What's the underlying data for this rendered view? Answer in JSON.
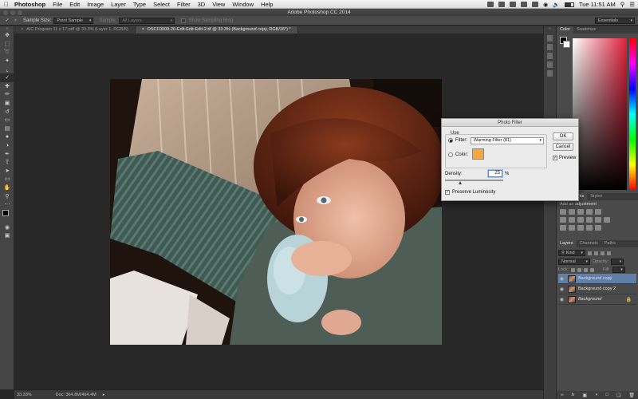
{
  "menubar": {
    "app": "Photoshop",
    "menus": [
      "File",
      "Edit",
      "Image",
      "Layer",
      "Type",
      "Select",
      "Filter",
      "3D",
      "View",
      "Window",
      "Help"
    ],
    "clock": "Tue 11:51 AM"
  },
  "window": {
    "title": "Adobe Photoshop CC 2014"
  },
  "options": {
    "sample_size_label": "Sample Size:",
    "sample_size_value": "Point Sample",
    "sample_label": "Sample:",
    "sample_value": "All Layers",
    "sampling_ring": "Show Sampling Ring",
    "workspace": "Essentials"
  },
  "tabs": [
    {
      "label": "AIC Program 11 x 17.pdf @ 33.3% (Layer 1, RGB/8)"
    },
    {
      "label": "DSCF0009-20-Edit-Edit-Edit-2.tif @ 33.3% (Background copy, RGB/16*) *"
    }
  ],
  "status": {
    "zoom": "33.33%",
    "doc": "Doc: 364.8M/494.4M"
  },
  "color_panel": {
    "tabs": [
      "Color",
      "Swatches"
    ]
  },
  "adjustments": {
    "tabs": [
      "Adjustments",
      "Styles"
    ],
    "hint": "Add an adjustment"
  },
  "layers_panel": {
    "tabs": [
      "Layers",
      "Channels",
      "Paths"
    ],
    "kind": "Kind",
    "blend_mode": "Normal",
    "opacity_label": "Opacity:",
    "lock_label": "Lock:",
    "fill_label": "Fill:",
    "layers": [
      {
        "name": "Background copy",
        "selected": true
      },
      {
        "name": "Background copy 2",
        "selected": false
      },
      {
        "name": "Background",
        "selected": false
      }
    ]
  },
  "dialog": {
    "title": "Photo Filter",
    "use_label": "Use",
    "filter_label": "Filter:",
    "filter_value": "Warming Filter (81)",
    "color_label": "Color:",
    "swatch_color": "#f5a742",
    "density_label": "Density:",
    "density_value": "25",
    "density_unit": "%",
    "preserve_label": "Preserve Luminosity",
    "ok": "OK",
    "cancel": "Cancel",
    "preview": "Preview"
  },
  "icons": [
    "move-icon",
    "marquee-icon",
    "lasso-icon",
    "quick-select-icon",
    "crop-icon",
    "eyedropper-icon",
    "healing-icon",
    "brush-icon",
    "stamp-icon",
    "history-brush-icon",
    "eraser-icon",
    "gradient-icon",
    "blur-icon",
    "dodge-icon",
    "pen-icon",
    "type-icon",
    "path-select-icon",
    "shape-icon",
    "hand-icon",
    "zoom-icon"
  ]
}
